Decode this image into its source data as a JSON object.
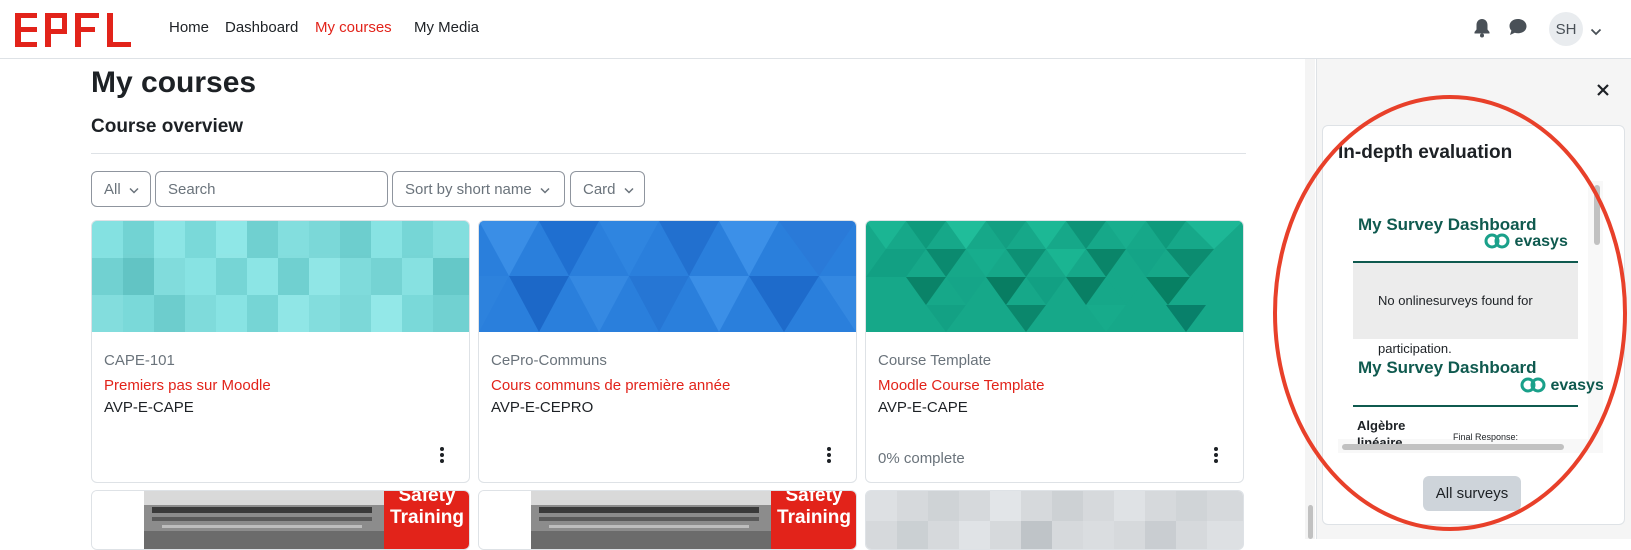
{
  "brand": {
    "logo_text": "EPFL",
    "accent": "#e2231a"
  },
  "nav": {
    "items": [
      {
        "label": "Home",
        "active": false
      },
      {
        "label": "Dashboard",
        "active": false
      },
      {
        "label": "My courses",
        "active": true
      },
      {
        "label": "My Media",
        "active": false
      }
    ],
    "icons": [
      "bell-icon",
      "chat-icon"
    ],
    "user_initials": "SH"
  },
  "main": {
    "page_title": "My courses",
    "section_title": "Course overview",
    "filters": {
      "grouping": "All",
      "search_placeholder": "Search",
      "sort": "Sort by short name",
      "view": "Card"
    },
    "courses": [
      {
        "short_name": "CAPE-101",
        "full_name": "Premiers pas sur Moodle",
        "category": "AVP-E-CAPE",
        "progress_text": ""
      },
      {
        "short_name": "CePro-Communs",
        "full_name": "Cours communs de première année",
        "category": "AVP-E-CEPRO",
        "progress_text": ""
      },
      {
        "short_name": "Course Template",
        "full_name": "Moodle Course Template",
        "category": "AVP-E-CAPE",
        "progress_text": "0% complete"
      }
    ],
    "partial_cards": [
      {
        "badge_line1": "Safety",
        "badge_line2": "Training"
      },
      {
        "badge_line1": "Safety",
        "badge_line2": "Training"
      }
    ]
  },
  "drawer": {
    "block_title": "In-depth evaluation",
    "survey": {
      "dashboard_title": "My Survey Dashboard",
      "brand": "evasys",
      "empty_line1": "No onlinesurveys found for",
      "empty_line2": "participation.",
      "course_line1": "Algèbre",
      "course_line2": "linéaire",
      "final_response": "Final Response:"
    },
    "all_surveys_label": "All surveys"
  },
  "colors": {
    "annotation": "#e8402a",
    "survey_green": "#0f5a4f",
    "link_red": "#e2231a"
  }
}
